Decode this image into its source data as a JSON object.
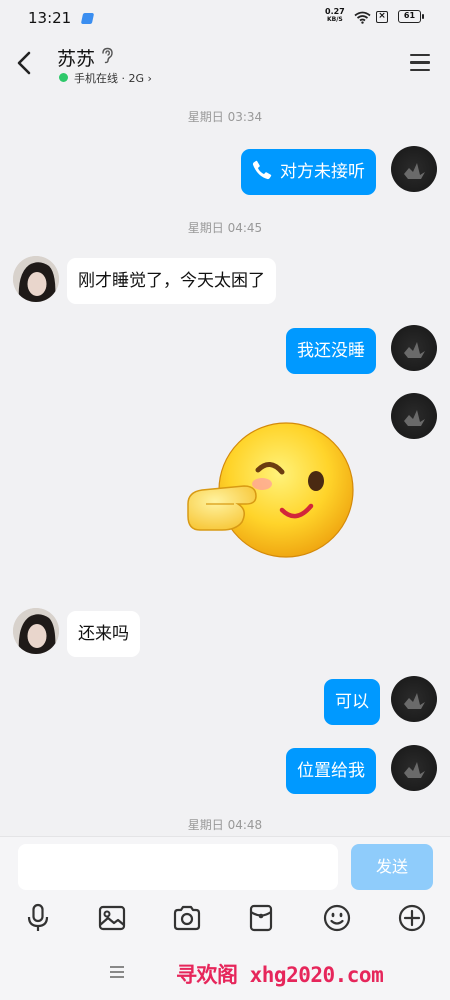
{
  "status_bar": {
    "time": "13:21",
    "net_speed_value": "0.27",
    "net_speed_unit": "KB/S",
    "battery": "61"
  },
  "header": {
    "contact_name": "苏苏",
    "online_status": "手机在线 · 2G",
    "online_color": "#2ec86a"
  },
  "messages": {
    "time_1": "星期日 03:34",
    "call_text": "对方未接听",
    "time_2": "星期日 04:45",
    "msg_1": "刚才睡觉了，今天太困了",
    "msg_2": "我还没睡",
    "msg_3": "还来吗",
    "msg_4": "可以",
    "msg_5": "位置给我",
    "time_3": "星期日 04:48"
  },
  "input_bar": {
    "placeholder": "",
    "value": "",
    "send_label": "发送"
  },
  "toolbar": {
    "icons": [
      "mic-icon",
      "image-icon",
      "camera-icon",
      "red-packet-icon",
      "emoji-icon",
      "plus-icon"
    ]
  },
  "footer": {
    "watermark": "寻欢阁 xhg2020.com"
  },
  "colors": {
    "accent": "#0099ff",
    "send_disabled": "#8fccfb",
    "watermark": "#e6265b"
  }
}
